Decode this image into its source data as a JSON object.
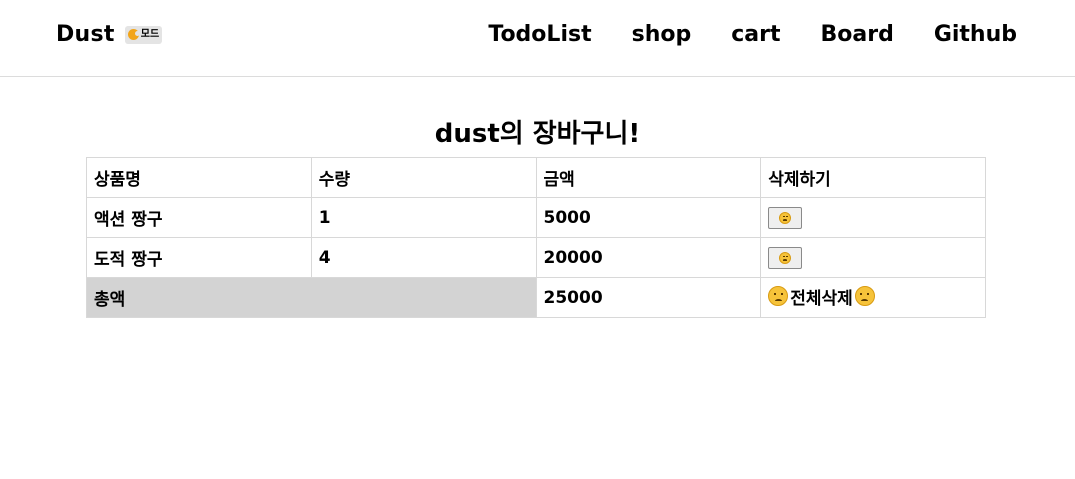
{
  "navbar": {
    "brand": "Dust",
    "mode_toggle_label": "모드",
    "links": [
      "TodoList",
      "shop",
      "cart",
      "Board",
      "Github"
    ]
  },
  "page": {
    "title": "dust의 장바구니!"
  },
  "table": {
    "headers": [
      "상품명",
      "수량",
      "금액",
      "삭제하기"
    ],
    "rows": [
      {
        "name": "액션 짱구",
        "qty": "1",
        "price": "5000",
        "delete_icon": "sad-face"
      },
      {
        "name": "도적 짱구",
        "qty": "4",
        "price": "20000",
        "delete_icon": "sad-face"
      }
    ],
    "total_label": "총액",
    "total_value": "25000",
    "clear_all_label": "전체삭제"
  },
  "colors": {
    "total_label_bg": "#d3d3d3",
    "border": "#d8d8d8"
  }
}
